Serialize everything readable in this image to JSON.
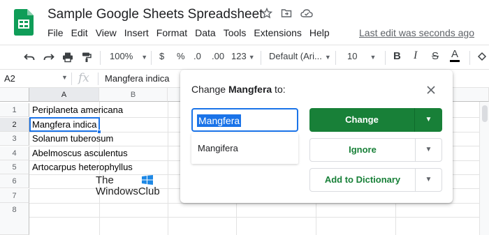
{
  "header": {
    "title": "Sample Google Sheets Spreadsheet",
    "title_icons": [
      "star-icon",
      "move-to-folder-icon",
      "cloud-status-icon"
    ],
    "menu": [
      "File",
      "Edit",
      "View",
      "Insert",
      "Format",
      "Data",
      "Tools",
      "Extensions",
      "Help"
    ],
    "last_edit": "Last edit was seconds ago"
  },
  "toolbar": {
    "zoom": "100%",
    "currency": "$",
    "percent": "%",
    "decrease_decimal": ".0",
    "increase_decimal": ".00",
    "more_formats": "123",
    "font": "Default (Ari...",
    "font_size": "10",
    "bold": "B",
    "italic": "I",
    "strike": "S",
    "text_color": "A"
  },
  "formula_bar": {
    "name_box": "A2",
    "fx": "fx",
    "value": "Mangfera indica"
  },
  "grid": {
    "columns": [
      "A",
      "B"
    ],
    "rows": [
      "1",
      "2",
      "3",
      "4",
      "5",
      "6",
      "7",
      "8"
    ],
    "cells": [
      "Periplaneta americana",
      "Mangfera indica",
      "Solanum tuberosum",
      "Abelmoscus asculentus",
      "Artocarpus heterophyllus"
    ],
    "selected_cell": "A2"
  },
  "watermark": {
    "line1": "The",
    "line2": "WindowsClub"
  },
  "dialog": {
    "title_prefix": "Change ",
    "title_word": "Mangfera",
    "title_suffix": " to:",
    "input_value": "Mangfera",
    "suggestion": "Mangifera",
    "change_label": "Change",
    "ignore_label": "Ignore",
    "add_label": "Add to Dictionary"
  },
  "colors": {
    "accent": "#1a73e8",
    "green": "#188038",
    "sheets_logo": "#0f9d58"
  }
}
